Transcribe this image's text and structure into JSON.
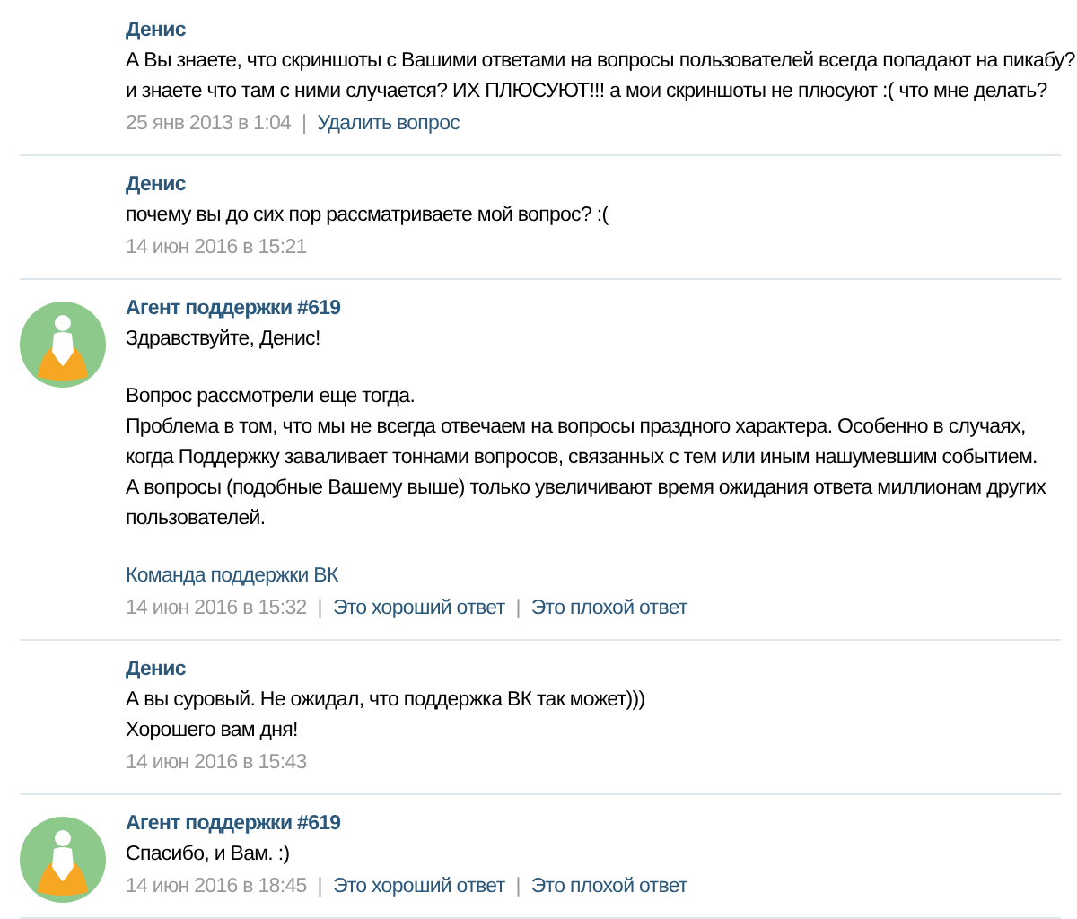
{
  "separator": "|",
  "messages": [
    {
      "kind": "user",
      "author": "Денис",
      "blocks": [
        [
          "А Вы знаете, что скриншоты с Вашими ответами на вопросы пользователей всегда попадают на пикабу?",
          "и знаете что там с ними случается? ИХ ПЛЮСУЮТ!!! а мои скриншоты не плюсуют :( что мне делать?"
        ]
      ],
      "date": "25 янв 2013 в 1:04",
      "links": [
        "Удалить вопрос"
      ]
    },
    {
      "kind": "user",
      "author": "Денис",
      "blocks": [
        [
          "почему вы до сих пор рассматриваете мой вопрос? :("
        ]
      ],
      "date": "14 июн 2016 в 15:21"
    },
    {
      "kind": "agent",
      "author": "Агент поддержки #619",
      "blocks": [
        [
          "Здравствуйте, Денис!"
        ],
        [
          "Вопрос рассмотрели еще тогда.",
          "Проблема в том, что мы не всегда отвечаем на вопросы праздного характера. Особенно в случаях,",
          "когда Поддержку заваливает тоннами вопросов, связанных с тем или иным нашумевшим событием.",
          "А вопросы (подобные Вашему выше) только увеличивают время ожидания ответа миллионам других",
          "пользователей."
        ]
      ],
      "signature": "Команда поддержки ВК",
      "date": "14 июн 2016 в 15:32",
      "links": [
        "Это хороший ответ",
        "Это плохой ответ"
      ]
    },
    {
      "kind": "user",
      "author": "Денис",
      "blocks": [
        [
          "А вы суровый. Не ожидал, что поддержка ВК так может)))",
          "Хорошего вам дня!"
        ]
      ],
      "date": "14 июн 2016 в 15:43"
    },
    {
      "kind": "agent",
      "author": "Агент поддержки #619",
      "blocks": [
        [
          "Спасибо, и Вам. :)"
        ]
      ],
      "date": "14 июн 2016 в 18:45",
      "links": [
        "Это хороший ответ",
        "Это плохой ответ"
      ]
    }
  ]
}
